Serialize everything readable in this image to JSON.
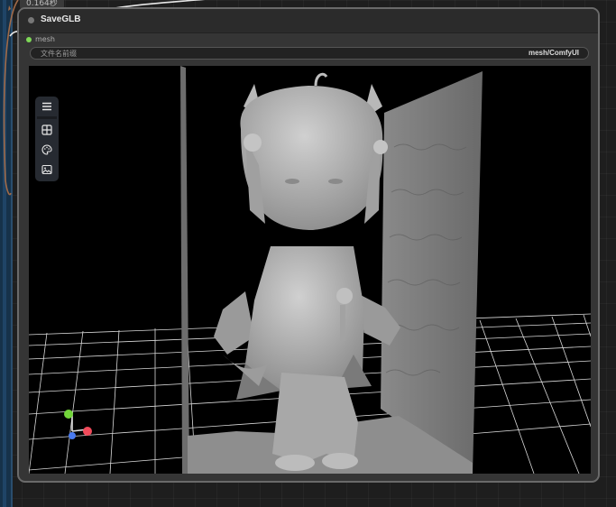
{
  "execution": {
    "time": "0.164秒"
  },
  "node": {
    "title": "SaveGLB",
    "input": {
      "label": "mesh",
      "color": "#7ed957"
    },
    "widget": {
      "label": "文件名前缀",
      "value": "mesh/ComfyUI"
    }
  },
  "viewer": {
    "toolbar": [
      {
        "icon": "menu-icon"
      },
      {
        "icon": "grid-icon"
      },
      {
        "icon": "palette-icon"
      },
      {
        "icon": "image-icon"
      }
    ],
    "axis_colors": {
      "x": "#f04a5a",
      "y": "#72d53a",
      "z": "#4a7bf0"
    },
    "background": "#000000"
  }
}
